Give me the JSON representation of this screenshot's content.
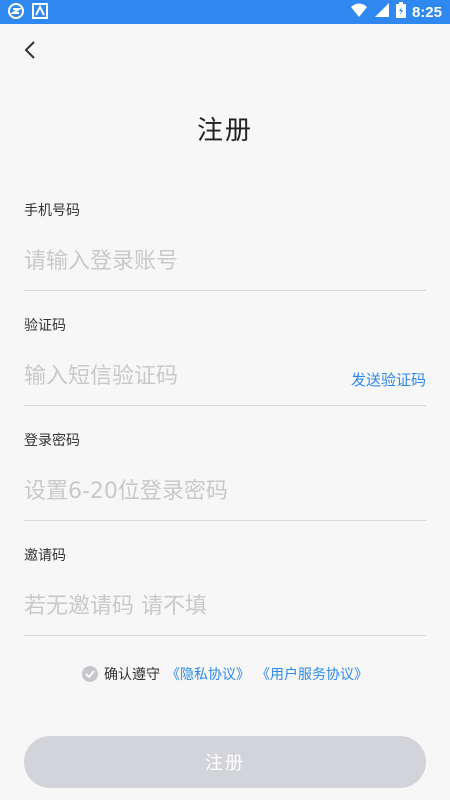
{
  "status_bar": {
    "time": "8:25",
    "colors": {
      "bar": "#2f88f0"
    }
  },
  "page": {
    "title": "注册"
  },
  "form": {
    "phone": {
      "label": "手机号码",
      "placeholder": "请输入登录账号"
    },
    "code": {
      "label": "验证码",
      "placeholder": "输入短信验证码",
      "send_label": "发送验证码"
    },
    "password": {
      "label": "登录密码",
      "placeholder": "设置6-20位登录密码"
    },
    "invite": {
      "label": "邀请码",
      "placeholder": "若无邀请码 请不填"
    }
  },
  "agreement": {
    "prefix": "确认遵守",
    "privacy": "《隐私协议》",
    "service": "《用户服务协议》"
  },
  "actions": {
    "register_label": "注册"
  },
  "colors": {
    "accent": "#2f88f0",
    "button_disabled": "#d2d4d9",
    "placeholder": "#c9c9cc"
  },
  "icons": [
    "status-icon-1",
    "status-icon-2",
    "wifi-icon",
    "signal-icon",
    "battery-icon",
    "back-icon",
    "check-icon"
  ]
}
